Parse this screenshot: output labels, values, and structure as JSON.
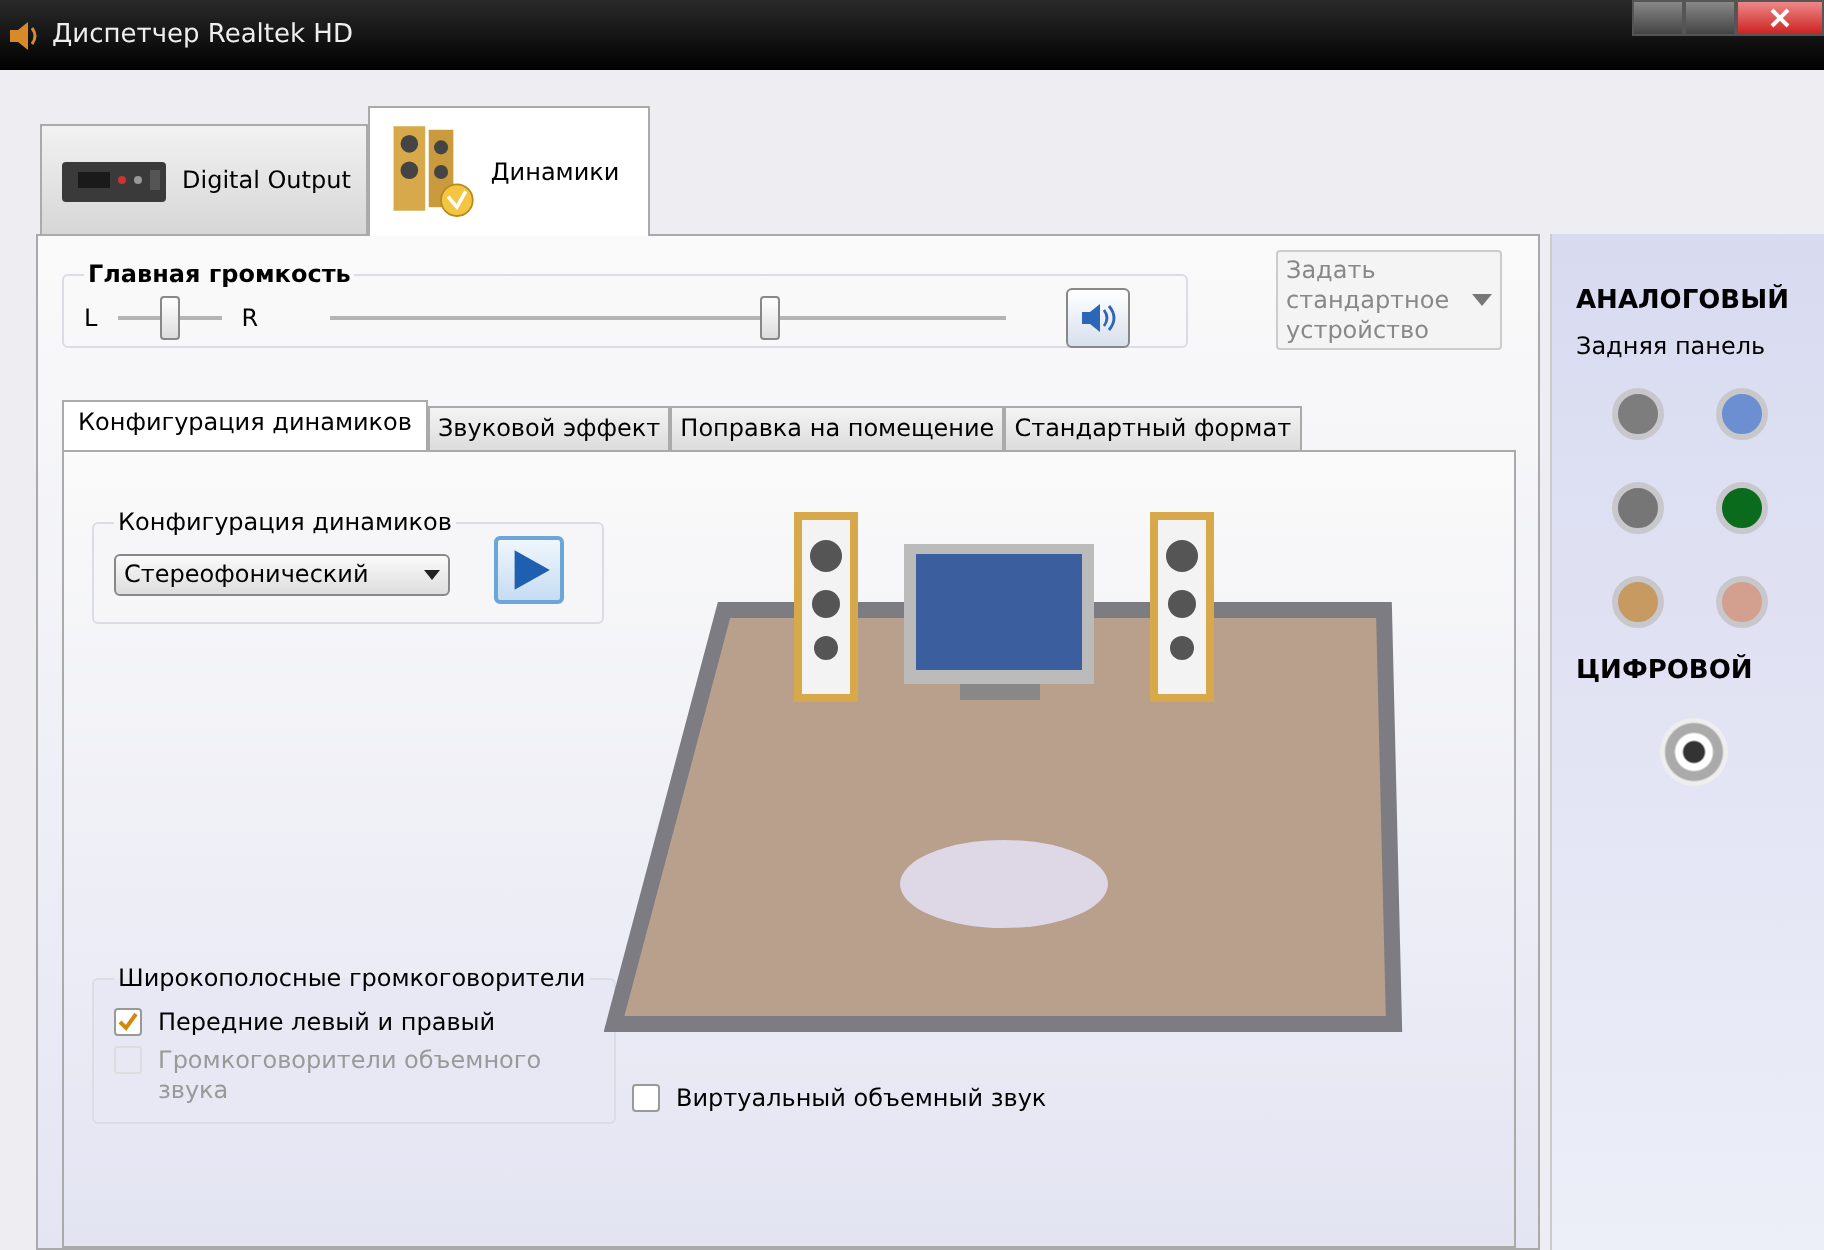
{
  "window": {
    "title": "Диспетчер Realtek HD"
  },
  "device_tabs": [
    {
      "label": "Digital Output",
      "kind": "digital",
      "selected": false
    },
    {
      "label": "Динамики",
      "kind": "speakers",
      "selected": true
    }
  ],
  "master_volume": {
    "label": "Главная громкость",
    "left_label": "L",
    "right_label": "R",
    "balance": {
      "level": 0.5
    },
    "volume": {
      "level": 0.65
    }
  },
  "default_device": {
    "label": "Задать стандартное устройство",
    "disabled": true
  },
  "sub_tabs": [
    {
      "label": "Конфигурация динамиков",
      "selected": true
    },
    {
      "label": "Звуковой эффект",
      "selected": false
    },
    {
      "label": "Поправка на помещение",
      "selected": false
    },
    {
      "label": "Стандартный формат",
      "selected": false
    }
  ],
  "speaker_config": {
    "label": "Конфигурация динамиков",
    "value": "Стереофонический"
  },
  "wideband": {
    "label": "Широкополосные громкоговорители",
    "items": [
      {
        "label": "Передние левый и правый",
        "checked": true,
        "disabled": false
      },
      {
        "label": "Громкоговорители объемного звука",
        "checked": false,
        "disabled": true
      }
    ]
  },
  "virtual_surround": {
    "label": "Виртуальный объемный звук",
    "checked": false
  },
  "jacks_panel": {
    "analog_heading": "АНАЛОГОВЫЙ",
    "rear_panel_label": "Задняя панель",
    "jacks": [
      {
        "color": "#7d7d7d"
      },
      {
        "color": "#6b8fd0"
      },
      {
        "color": "#767676"
      },
      {
        "color": "#0b6b1c"
      },
      {
        "color": "#c79a62"
      },
      {
        "color": "#d3a08f"
      }
    ],
    "digital_heading": "ЦИФРОВОЙ"
  }
}
